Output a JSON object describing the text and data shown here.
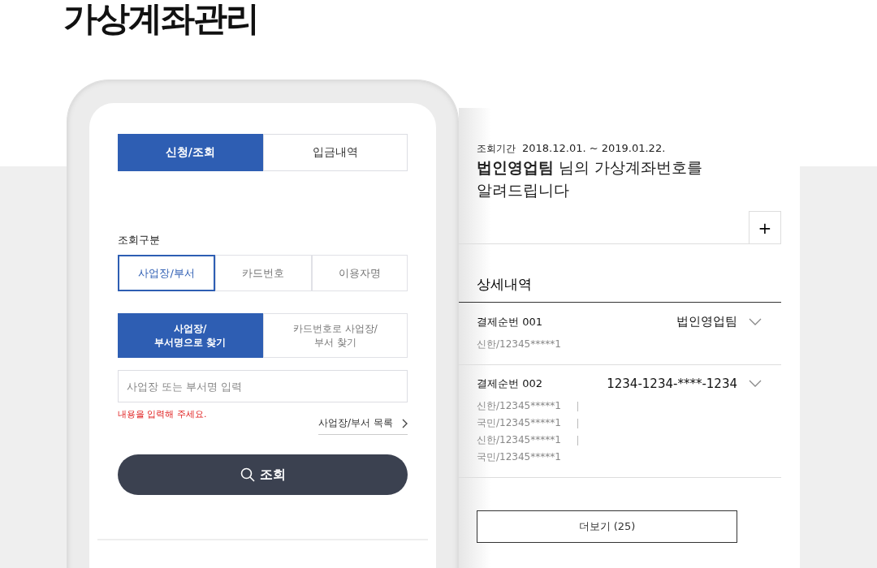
{
  "page_title": "가상계좌관리",
  "phone": {
    "tabs": [
      {
        "label": "신청/조회",
        "selected": true
      },
      {
        "label": "입금내역",
        "selected": false
      }
    ],
    "category_label": "조회구분",
    "category_options": [
      {
        "label": "사업장/부서",
        "selected": true
      },
      {
        "label": "카드번호",
        "selected": false
      },
      {
        "label": "이용자명",
        "selected": false
      }
    ],
    "search_modes": [
      {
        "lines": [
          "사업장/",
          "부서명으로 찾기"
        ],
        "selected": true
      },
      {
        "lines": [
          "카드번호로 사업장/",
          "부서 찾기"
        ],
        "selected": false
      }
    ],
    "search_field": {
      "placeholder": "사업장 또는 부서명 입력"
    },
    "error": "내용을 입력해 주세요.",
    "list_link": "사업장/부서 목록",
    "search_button": "조회"
  },
  "result": {
    "period_label": "조회기간",
    "period": "2018.12.01. ~ 2019.01.22.",
    "message_lines": [
      "**법인영업팀** 님의 가상계좌번호를",
      "알려드립니다"
    ],
    "expand_button": "+",
    "detail_title": "상세내역",
    "items": [
      {
        "label": "결제순번 001",
        "value": "법인영업팀",
        "accounts": [
          {
            "text": "신한/12345*****1",
            "separator": false
          }
        ]
      },
      {
        "label": "결제순번 002",
        "value": "1234-1234-****-1234",
        "accounts": [
          {
            "text": "신한/12345*****1",
            "separator": true
          },
          {
            "text": "국민/12345*****1",
            "separator": true
          },
          {
            "text": "신한/12345*****1",
            "separator": true
          },
          {
            "text": "국민/12345*****1",
            "separator": false
          }
        ]
      }
    ],
    "more_button": "더보기 (25)"
  }
}
